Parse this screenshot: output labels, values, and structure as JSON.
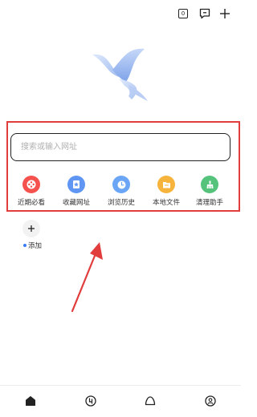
{
  "top_bar": {
    "tab_count": "0",
    "icons": [
      "tab-count-icon",
      "message-icon",
      "plus-icon"
    ]
  },
  "search": {
    "placeholder": "搜索或输入网址",
    "value": ""
  },
  "quick_access": [
    {
      "label": "近期必看",
      "icon": "film-reel-icon",
      "color": "#f4514f"
    },
    {
      "label": "收藏网址",
      "icon": "star-bookmark-icon",
      "color": "#5f96f4"
    },
    {
      "label": "浏览历史",
      "icon": "clock-icon",
      "color": "#6ba6f6"
    },
    {
      "label": "本地文件",
      "icon": "folder-icon",
      "color": "#f7b43c"
    },
    {
      "label": "清理助手",
      "icon": "broom-icon",
      "color": "#55c37c"
    }
  ],
  "add_shortcut": {
    "label": "添加",
    "dot_color": "#3b7bf6"
  },
  "bottom_nav": [
    "home-icon",
    "grid-icon",
    "cloud-icon",
    "profile-icon"
  ],
  "colors": {
    "highlight": "#e23d3d",
    "arrow": "#e23d3d",
    "accent": "#3b7bf6"
  }
}
